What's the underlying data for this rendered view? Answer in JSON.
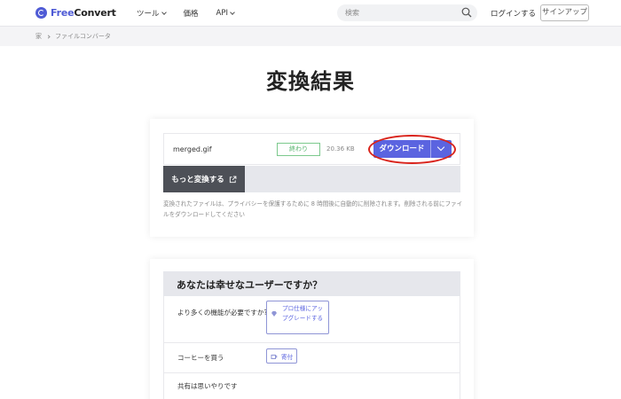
{
  "header": {
    "brand_prefix": "Free",
    "brand_suffix": "Convert",
    "nav": [
      {
        "label": "ツール"
      },
      {
        "label": "価格"
      },
      {
        "label": "API"
      }
    ],
    "search_placeholder": "検索",
    "login_label": "ログインする",
    "signup_label": "サインアップ"
  },
  "breadcrumb": {
    "home": "家",
    "current": "ファイルコンバータ"
  },
  "page_title": "変換結果",
  "result": {
    "file_name": "merged.gif",
    "status": "終わり",
    "file_size": "20.36 KB",
    "download_label": "ダウンロード",
    "convert_more_label": "もっと変換する",
    "notice": "変換されたファイルは、プライバシーを保護するために 8 時間後に自動的に削除されます。削除される前にファイルをダウンロードしてください"
  },
  "feedback": {
    "title": "あなたは幸せなユーザーですか？",
    "rows": [
      {
        "question": "より多くの機能が必要ですか?",
        "button": "プロ仕様にアップグレードする"
      },
      {
        "question": "コーヒーを買う",
        "button": "寄付"
      },
      {
        "question": "共有は思いやりです"
      }
    ]
  },
  "colors": {
    "brand": "#4f5bd5",
    "download": "#5b64e0",
    "status_green": "#4caf64",
    "highlight_ring": "#d9241c"
  },
  "icons": [
    "logo-icon",
    "search-icon",
    "chevron-down-icon",
    "external-link-icon",
    "diamond-icon",
    "coffee-cup-icon"
  ]
}
